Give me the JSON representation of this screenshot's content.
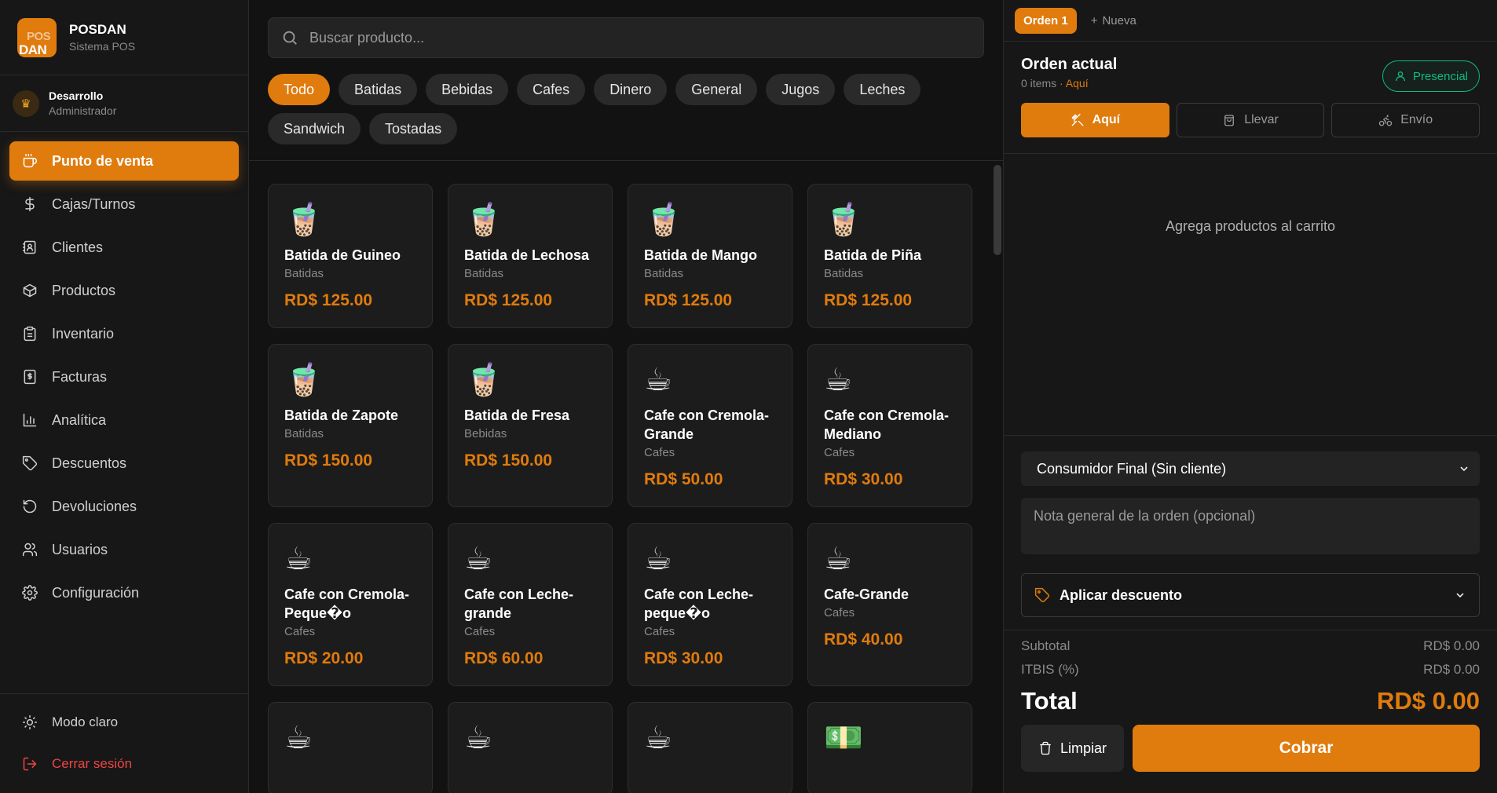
{
  "brand": {
    "logo_top": "POS",
    "logo_bottom": "DAN",
    "name": "POSDAN",
    "subtitle": "Sistema POS"
  },
  "user": {
    "name": "Desarrollo",
    "role": "Administrador",
    "avatar_icon": "crown-icon"
  },
  "nav": {
    "items": [
      {
        "label": "Punto de venta",
        "icon": "coffee-cup-icon",
        "active": true
      },
      {
        "label": "Cajas/Turnos",
        "icon": "dollar-icon"
      },
      {
        "label": "Clientes",
        "icon": "contact-card-icon"
      },
      {
        "label": "Productos",
        "icon": "box-icon"
      },
      {
        "label": "Inventario",
        "icon": "clipboard-icon"
      },
      {
        "label": "Facturas",
        "icon": "invoice-icon"
      },
      {
        "label": "Analítica",
        "icon": "bar-chart-icon"
      },
      {
        "label": "Descuentos",
        "icon": "tag-icon"
      },
      {
        "label": "Devoluciones",
        "icon": "rotate-ccw-icon"
      },
      {
        "label": "Usuarios",
        "icon": "users-icon"
      },
      {
        "label": "Configuración",
        "icon": "gear-icon"
      }
    ],
    "theme_toggle": "Modo claro",
    "logout": "Cerrar sesión"
  },
  "search": {
    "placeholder": "Buscar producto...",
    "value": ""
  },
  "categories": [
    "Todo",
    "Batidas",
    "Bebidas",
    "Cafes",
    "Dinero",
    "General",
    "Jugos",
    "Leches",
    "Sandwich",
    "Tostadas"
  ],
  "active_category": "Todo",
  "products": [
    {
      "name": "Batida de Guineo",
      "category": "Batidas",
      "price": "RD$ 125.00",
      "emoji": "🧋"
    },
    {
      "name": "Batida de Lechosa",
      "category": "Batidas",
      "price": "RD$ 125.00",
      "emoji": "🧋"
    },
    {
      "name": "Batida de Mango",
      "category": "Batidas",
      "price": "RD$ 125.00",
      "emoji": "🧋"
    },
    {
      "name": "Batida de Piña",
      "category": "Batidas",
      "price": "RD$ 125.00",
      "emoji": "🧋"
    },
    {
      "name": "Batida de Zapote",
      "category": "Batidas",
      "price": "RD$ 150.00",
      "emoji": "🧋"
    },
    {
      "name": "Batida de Fresa",
      "category": "Bebidas",
      "price": "RD$ 150.00",
      "emoji": "🧋"
    },
    {
      "name": "Cafe con Cremola-Grande",
      "category": "Cafes",
      "price": "RD$ 50.00",
      "emoji": "☕"
    },
    {
      "name": "Cafe con Cremola-Mediano",
      "category": "Cafes",
      "price": "RD$ 30.00",
      "emoji": "☕"
    },
    {
      "name": "Cafe con Cremola-Peque�o",
      "category": "Cafes",
      "price": "RD$ 20.00",
      "emoji": "☕"
    },
    {
      "name": "Cafe con Leche-grande",
      "category": "Cafes",
      "price": "RD$ 60.00",
      "emoji": "☕"
    },
    {
      "name": "Cafe con Leche-peque�o",
      "category": "Cafes",
      "price": "RD$ 30.00",
      "emoji": "☕"
    },
    {
      "name": "Cafe-Grande",
      "category": "Cafes",
      "price": "RD$ 40.00",
      "emoji": "☕"
    },
    {
      "name": "",
      "category": "",
      "price": "",
      "emoji": "☕"
    },
    {
      "name": "",
      "category": "",
      "price": "",
      "emoji": "☕"
    },
    {
      "name": "",
      "category": "",
      "price": "",
      "emoji": "☕"
    },
    {
      "name": "",
      "category": "",
      "price": "",
      "emoji": "💵"
    }
  ],
  "order": {
    "tab_active": "Orden 1",
    "tab_new": "Nueva",
    "title": "Orden actual",
    "items_count": "0 items",
    "location": "· Aquí",
    "presencial": "Presencial",
    "modes": [
      "Aquí",
      "Llevar",
      "Envío"
    ],
    "empty_text": "Agrega productos al carrito",
    "customer": "Consumidor Final (Sin cliente)",
    "note_placeholder": "Nota general de la orden (opcional)",
    "discount_label": "Aplicar descuento",
    "subtotal_label": "Subtotal",
    "subtotal_value": "RD$ 0.00",
    "tax_label": "ITBIS (%)",
    "tax_value": "RD$ 0.00",
    "total_label": "Total",
    "total_value": "RD$ 0.00",
    "clear_label": "Limpiar",
    "pay_label": "Cobrar"
  },
  "colors": {
    "accent": "#e07b0d",
    "success": "#10b981",
    "danger": "#ef4444",
    "background": "#121212"
  }
}
